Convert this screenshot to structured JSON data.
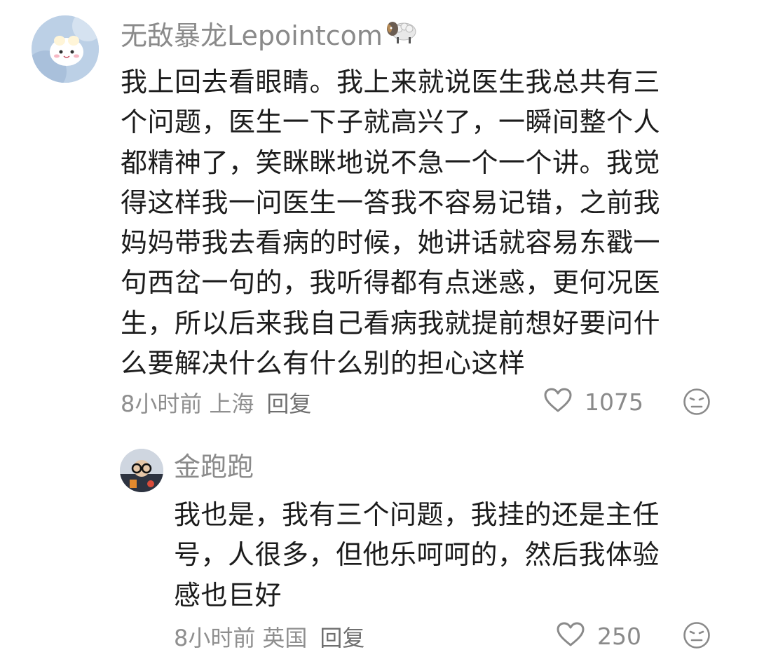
{
  "comments": [
    {
      "username": "无敌暴龙Lepointcom",
      "badge": "ram-emoji-icon",
      "lines": [
        "我上回去看眼睛。我上来就说医生我总共有三",
        "个问题，医生一下子就高兴了，一瞬间整个人",
        "都精神了，笑眯眯地说不急一个一个讲。我觉",
        "得这样我一问医生一答我不容易记错，之前我",
        "妈妈带我去看病的时候，她讲话就容易东戳一",
        "句西岔一句的，我听得都有点迷惑，更何况医",
        "生，所以后来我自己看病我就提前想好要问什",
        "么要解决什么有什么别的担心这样"
      ],
      "time": "8小时前",
      "location": "上海",
      "reply_label": "回复",
      "likes": "1075"
    },
    {
      "username": "金跑跑",
      "lines": [
        "我也是，我有三个问题，我挂的还是主任",
        "号，人很多，但他乐呵呵的，然后我体验",
        "感也巨好"
      ],
      "time": "8小时前",
      "location": "英国",
      "reply_label": "回复",
      "likes": "250"
    }
  ],
  "colors": {
    "meta": "#8f8f8f",
    "text": "#1c1c1c",
    "icon": "#8a8a8a"
  }
}
